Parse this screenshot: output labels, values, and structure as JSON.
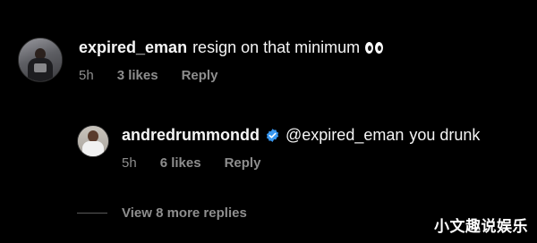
{
  "comments": [
    {
      "username": "expired_eman",
      "text": "resign on that minimum",
      "trailing_emoji": "eyes-emoji",
      "time": "5h",
      "likes": "3 likes",
      "reply_label": "Reply"
    }
  ],
  "replies": [
    {
      "username": "andredrummondd",
      "verified": true,
      "mention": "@expired_eman",
      "text": "you drunk",
      "time": "5h",
      "likes": "6 likes",
      "reply_label": "Reply"
    }
  ],
  "view_more_replies": "View 8 more replies",
  "watermark": "小文趣说娱乐",
  "colors": {
    "background": "#000000",
    "text_primary": "#f5f5f5",
    "text_secondary": "#8e8e8e",
    "verified_badge": "#3897f0"
  }
}
